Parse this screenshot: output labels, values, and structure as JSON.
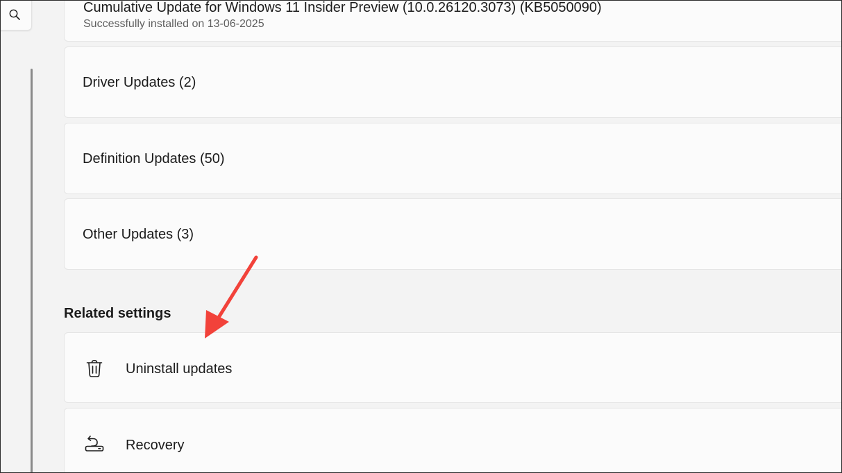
{
  "search": {
    "icon": "search-icon"
  },
  "update_history": {
    "last_quality_update": {
      "title": "Cumulative Update for Windows 11 Insider Preview (10.0.26120.3073) (KB5050090)",
      "status": "Successfully installed on 13-06-2025"
    },
    "categories": [
      {
        "label": "Driver Updates (2)"
      },
      {
        "label": "Definition Updates (50)"
      },
      {
        "label": "Other Updates (3)"
      }
    ]
  },
  "related_settings": {
    "heading": "Related settings",
    "items": [
      {
        "label": "Uninstall updates",
        "icon": "trash-icon"
      },
      {
        "label": "Recovery",
        "icon": "recovery-icon"
      }
    ]
  },
  "annotation": {
    "arrow_color": "#f2423a"
  }
}
